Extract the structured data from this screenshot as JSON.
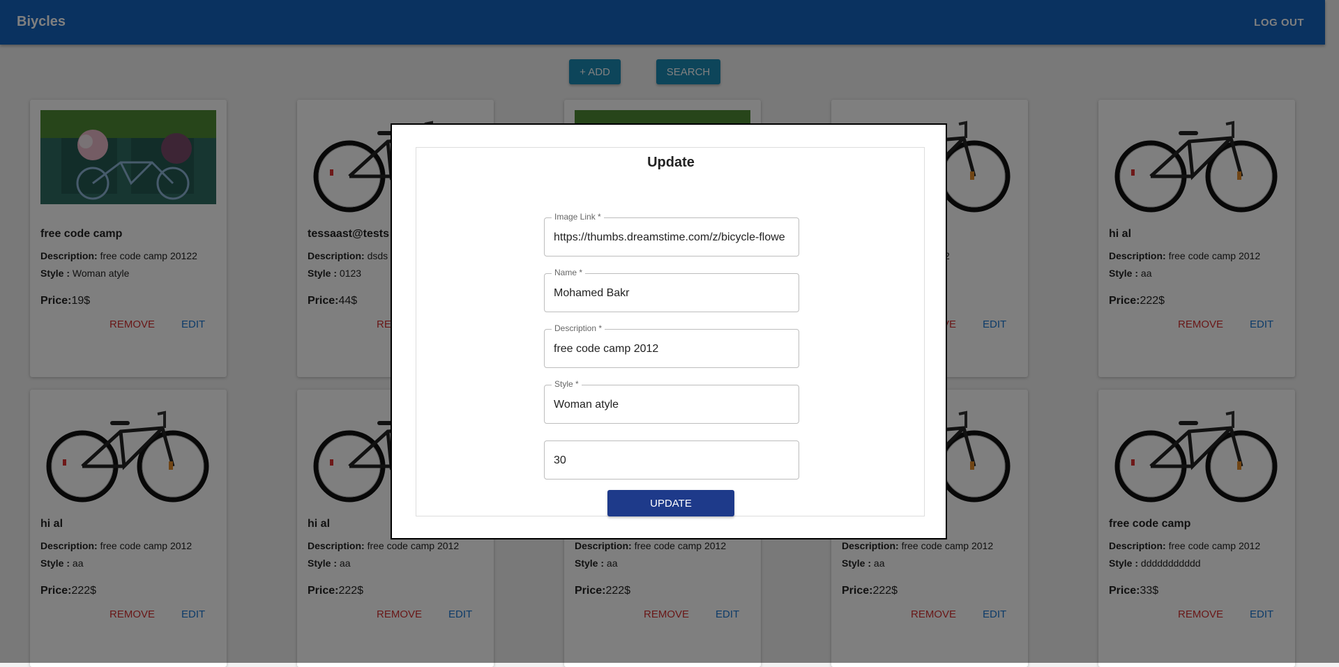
{
  "appbar": {
    "title": "Biycles",
    "logout": "LOG OUT"
  },
  "toolbar": {
    "add": "+ ADD",
    "search": "SEARCH"
  },
  "labels": {
    "description": "Description:",
    "style": "Style :",
    "price": "Price:",
    "remove": "REMOVE",
    "edit": "EDIT"
  },
  "cards": [
    {
      "image": "flower-bicycle-photo",
      "name": "free code camp",
      "description": "free code camp 20122",
      "style": "Woman atyle",
      "price": "19$"
    },
    {
      "image": "black-bicycle-photo",
      "name": "tessaast@tests",
      "description": "dsds",
      "style": "0123",
      "price": "44$"
    },
    {
      "image": "flower-bicycle-photo",
      "name": "",
      "description": "",
      "style": "",
      "price": ""
    },
    {
      "image": "black-bicycle-photo",
      "name": "",
      "description": "camp 2012",
      "style": "",
      "price": ""
    },
    {
      "image": "black-bicycle-photo",
      "name": "hi al",
      "description": "free code camp 2012",
      "style": "aa",
      "price": "222$"
    },
    {
      "image": "black-bicycle-photo",
      "name": "hi al",
      "description": "free code camp 2012",
      "style": "aa",
      "price": "222$"
    },
    {
      "image": "black-bicycle-photo",
      "name": "hi al",
      "description": "free code camp 2012",
      "style": "aa",
      "price": "222$"
    },
    {
      "image": "black-bicycle-photo",
      "name": "",
      "description": "free code camp 2012",
      "style": "aa",
      "price": "222$"
    },
    {
      "image": "black-bicycle-photo",
      "name": "",
      "description": "free code camp 2012",
      "style": "aa",
      "price": "222$"
    },
    {
      "image": "black-bicycle-photo",
      "name": "free code camp",
      "description": "free code camp 2012",
      "style": "ddddddddddd",
      "price": "33$"
    }
  ],
  "modal": {
    "title": "Update",
    "fields": [
      {
        "label": "Image Link *",
        "value": "https://thumbs.dreamstime.com/z/bicycle-flowe"
      },
      {
        "label": "Name *",
        "value": "Mohamed Bakr"
      },
      {
        "label": "Description *",
        "value": "free code camp 2012"
      },
      {
        "label": "Style *",
        "value": "Woman atyle"
      },
      {
        "label": "",
        "value": "30"
      }
    ],
    "submit": "UPDATE"
  },
  "colors": {
    "appbar": "#1565c0",
    "toolbar_button": "#1a8bb5",
    "remove": "#d32f2f",
    "edit": "#1976d2",
    "update_button": "#1e3a8a"
  }
}
